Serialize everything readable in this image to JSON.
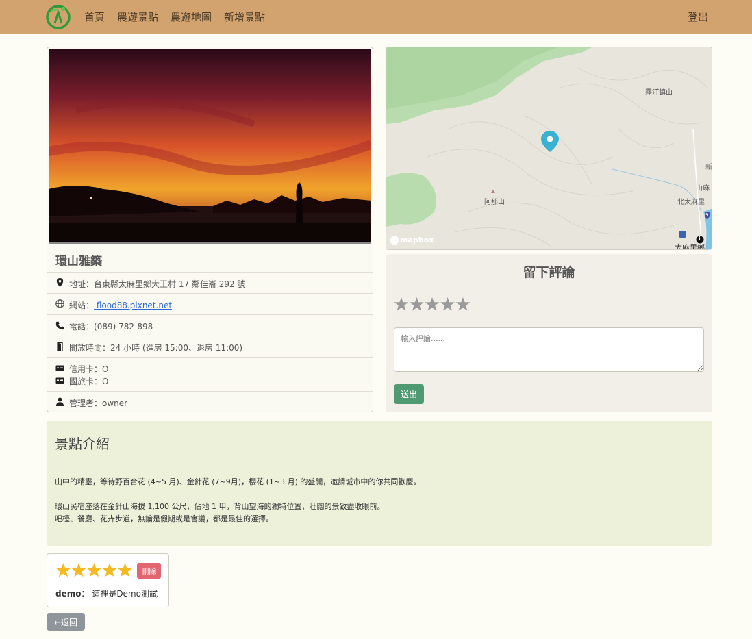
{
  "nav": {
    "links": [
      "首頁",
      "農遊景點",
      "農遊地圖",
      "新增景點"
    ],
    "logout": "登出"
  },
  "spot": {
    "name": "環山雅築",
    "address_label": "地址：",
    "address": "台東縣太麻里鄉大王村 17 鄰佳崙 292 號",
    "website_label": "網站：",
    "website": " flood88.pixnet.net",
    "phone_label": "電話：",
    "phone": "(089) 782-898",
    "hours_label": "開放時間：",
    "hours": "24 小時 (進房 15:00、退房 11:00)",
    "credit_label": "信用卡：",
    "credit": "O",
    "travel_card_label": "國旅卡：",
    "travel_card": "O",
    "manager_label": "管理者：",
    "manager": "owner"
  },
  "map": {
    "labels": [
      "霧汀鎮山",
      "新",
      "山麻",
      "北太麻里",
      "阿那山",
      "太麻里鄉"
    ],
    "attribution": "mapbox",
    "route_badge": "9",
    "info_icon": "i"
  },
  "review_form": {
    "title": "留下評論",
    "rating": 0,
    "placeholder": "輸入評論......",
    "submit": "送出"
  },
  "intro": {
    "title": "景點介紹",
    "p1": "山中的精靈，等待野百合花 (4~5 月)、金針花 (7~9月)，櫻花 (1~3 月) 的盛開，邀請城市中的你共同歡慶。",
    "p2": "環山民宿座落在金針山海拔 1,100 公尺，佔地 1 甲，背山望海的獨特位置，壯闊的景致盡收眼前。",
    "p3": "吧檯、餐廳、花卉步道，無論是假期或是會議，都是最佳的選擇。"
  },
  "comments": [
    {
      "rating": 5,
      "user": "demo：",
      "text": "這裡是Demo測試",
      "delete_label": "刪除"
    }
  ],
  "back": "←返回",
  "colors": {
    "navbar": "#d2a26f",
    "star_active": "#f5b921",
    "star_inactive": "#9a9a9a",
    "submit": "#4f9a73",
    "delete": "#e2656f"
  }
}
